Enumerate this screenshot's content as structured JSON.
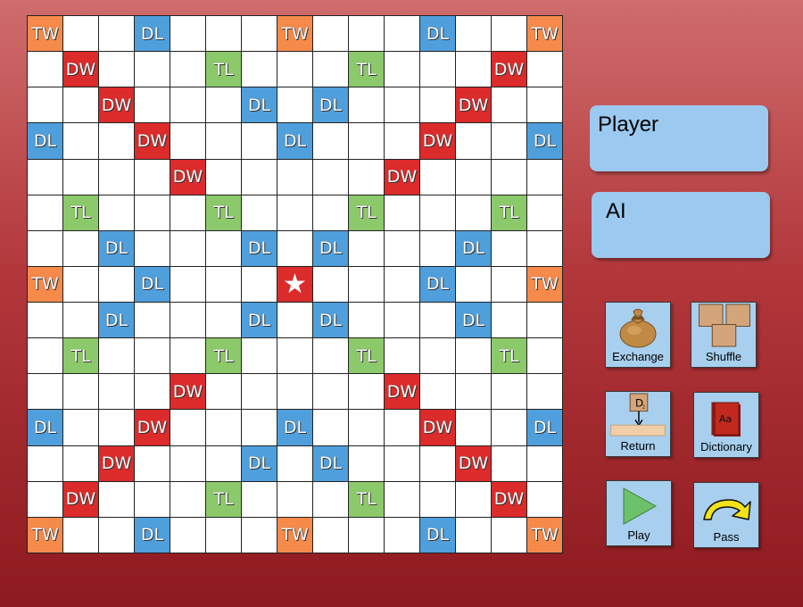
{
  "board": {
    "size": 15,
    "rows": [
      [
        "TW",
        "",
        "",
        "DL",
        "",
        "",
        "",
        "TW",
        "",
        "",
        "",
        "DL",
        "",
        "",
        "TW"
      ],
      [
        "",
        "DW",
        "",
        "",
        "",
        "TL",
        "",
        "",
        "",
        "TL",
        "",
        "",
        "",
        "DW",
        ""
      ],
      [
        "",
        "",
        "DW",
        "",
        "",
        "",
        "DL",
        "",
        "DL",
        "",
        "",
        "",
        "DW",
        "",
        ""
      ],
      [
        "DL",
        "",
        "",
        "DW",
        "",
        "",
        "",
        "DL",
        "",
        "",
        "",
        "DW",
        "",
        "",
        "DL"
      ],
      [
        "",
        "",
        "",
        "",
        "DW",
        "",
        "",
        "",
        "",
        "",
        "DW",
        "",
        "",
        "",
        ""
      ],
      [
        "",
        "TL",
        "",
        "",
        "",
        "TL",
        "",
        "",
        "",
        "TL",
        "",
        "",
        "",
        "TL",
        ""
      ],
      [
        "",
        "",
        "DL",
        "",
        "",
        "",
        "DL",
        "",
        "DL",
        "",
        "",
        "",
        "DL",
        "",
        ""
      ],
      [
        "TW",
        "",
        "",
        "DL",
        "",
        "",
        "",
        "★",
        "",
        "",
        "",
        "DL",
        "",
        "",
        "TW"
      ],
      [
        "",
        "",
        "DL",
        "",
        "",
        "",
        "DL",
        "",
        "DL",
        "",
        "",
        "",
        "DL",
        "",
        ""
      ],
      [
        "",
        "TL",
        "",
        "",
        "",
        "TL",
        "",
        "",
        "",
        "TL",
        "",
        "",
        "",
        "TL",
        ""
      ],
      [
        "",
        "",
        "",
        "",
        "DW",
        "",
        "",
        "",
        "",
        "",
        "DW",
        "",
        "",
        "",
        ""
      ],
      [
        "DL",
        "",
        "",
        "DW",
        "",
        "",
        "",
        "DL",
        "",
        "",
        "",
        "DW",
        "",
        "",
        "DL"
      ],
      [
        "",
        "",
        "DW",
        "",
        "",
        "",
        "DL",
        "",
        "DL",
        "",
        "",
        "",
        "DW",
        "",
        ""
      ],
      [
        "",
        "DW",
        "",
        "",
        "",
        "TL",
        "",
        "",
        "",
        "TL",
        "",
        "",
        "",
        "DW",
        ""
      ],
      [
        "TW",
        "",
        "",
        "DL",
        "",
        "",
        "",
        "TW",
        "",
        "",
        "",
        "DL",
        "",
        "",
        "TW"
      ]
    ]
  },
  "player_panel": {
    "name": "Player"
  },
  "ai_panel": {
    "name": "AI"
  },
  "buttons": {
    "exchange": "Exchange",
    "shuffle": "Shuffle",
    "return": "Return",
    "dictionary": "Dictionary",
    "play": "Play",
    "pass": "Pass"
  },
  "colors": {
    "TW": "#f58a4b",
    "DW": "#dc2b2b",
    "TL": "#8cc96a",
    "DL": "#4f9fdc"
  }
}
